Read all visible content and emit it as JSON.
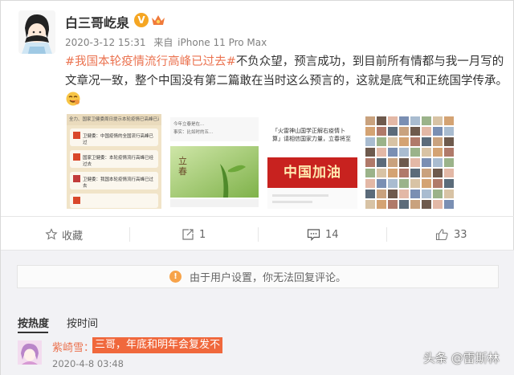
{
  "post": {
    "username": "白三哥屹泉",
    "vip_badge_glyph": "V",
    "time": "2020-3-12 15:31",
    "source_prefix": "来自",
    "source": "iPhone 11 Pro Max",
    "topic": "#我国本轮疫情流行高峰已过去#",
    "body": "不负众望，预言成功，到目前所有情都与我一月写的文章况一致，整个中国没有第二篇敢在当时这么预言的，这就是底气和正统国学传承。"
  },
  "images": {
    "img1": {
      "header": "全力、国家卫健委周日提示本轮疫情已高峰已过去",
      "items": [
        "卫健委：中国疫情的全国流行高峰已过",
        "国家卫健委：本轮疫情流行高峰已经过去",
        "卫健委：我国本轮疫情流行高峰已过去"
      ]
    },
    "img2": {
      "caption": "立春",
      "lines": [
        "今年立春是在...",
        "事实：比如时的五..."
      ]
    },
    "img3": {
      "title": "「火雷神山国学正解右疫情卜算」请相信国家力量，立春将至",
      "banner": "中国加油"
    }
  },
  "actions": {
    "favorite_label": "收藏",
    "repost_count": "1",
    "comment_count": "14",
    "like_count": "33"
  },
  "notice": {
    "text": "由于用户设置，你无法回复评论。"
  },
  "sort": {
    "hot_label": "按热度",
    "time_label": "按时间"
  },
  "comment": {
    "user": "紫崎雪",
    "colon": "：",
    "text": "三哥，年底和明年会复发不",
    "time": "2020-4-8 03:48"
  },
  "watermark": "头条 @雷斯林",
  "colors": {
    "accent": "#eb7350",
    "highlight_bg": "#f0683c",
    "vip": "#f5a623"
  }
}
